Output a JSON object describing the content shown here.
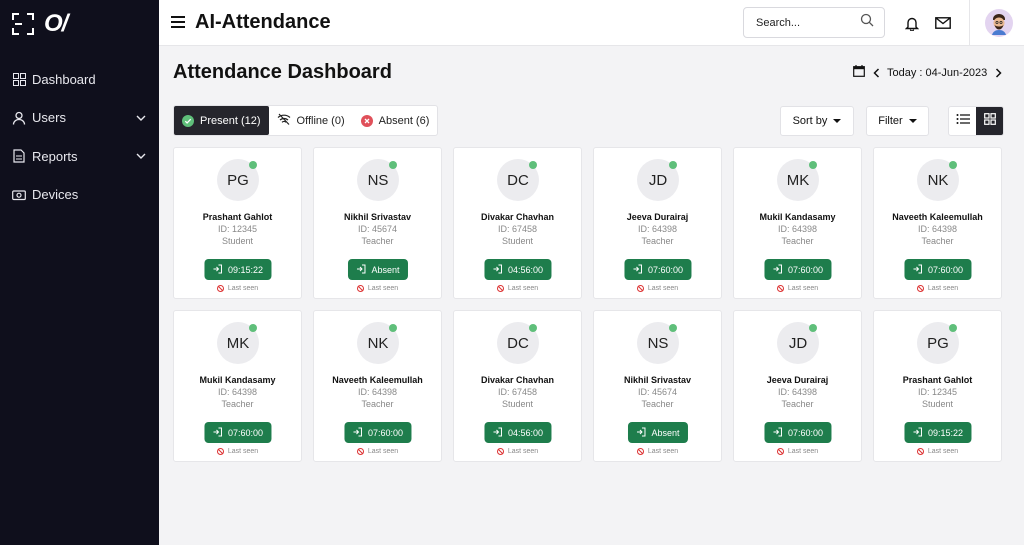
{
  "brand": {
    "logo_text": "O/"
  },
  "sidebar": {
    "items": [
      {
        "label": "Dashboard",
        "icon": "dashboard-icon",
        "has_chevron": false
      },
      {
        "label": "Users",
        "icon": "user-icon",
        "has_chevron": true
      },
      {
        "label": "Reports",
        "icon": "report-icon",
        "has_chevron": true
      },
      {
        "label": "Devices",
        "icon": "device-icon",
        "has_chevron": false
      }
    ]
  },
  "header": {
    "title": "AI-Attendance",
    "search_placeholder": "Search..."
  },
  "main": {
    "title": "Attendance Dashboard",
    "date_label": "Today : 04-Jun-2023",
    "tabs": [
      {
        "label": "Present (12)",
        "icon": "check-circle-icon",
        "active": true
      },
      {
        "label": "Offline (0)",
        "icon": "wifi-off-icon",
        "active": false
      },
      {
        "label": "Absent (6)",
        "icon": "x-circle-icon",
        "active": false
      }
    ],
    "sort_label": "Sort by",
    "filter_label": "Filter",
    "view_mode": "grid"
  },
  "colors": {
    "sidebar_bg": "#0f0f1c",
    "accent_green": "#1e7d4c",
    "online_dot": "#5fbf7a",
    "absent_red": "#e0505a"
  },
  "cards": [
    {
      "initials": "PG",
      "name": "Prashant Gahlot",
      "id": "ID: 12345",
      "role": "Student",
      "status": "09:15:22",
      "last_seen": "Last seen"
    },
    {
      "initials": "NS",
      "name": "Nikhil Srivastav",
      "id": "ID: 45674",
      "role": "Teacher",
      "status": "Absent",
      "last_seen": "Last seen"
    },
    {
      "initials": "DC",
      "name": "Divakar Chavhan",
      "id": "ID: 67458",
      "role": "Student",
      "status": "04:56:00",
      "last_seen": "Last seen"
    },
    {
      "initials": "JD",
      "name": "Jeeva Durairaj",
      "id": "ID: 64398",
      "role": "Teacher",
      "status": "07:60:00",
      "last_seen": "Last seen"
    },
    {
      "initials": "MK",
      "name": "Mukil Kandasamy",
      "id": "ID: 64398",
      "role": "Teacher",
      "status": "07:60:00",
      "last_seen": "Last seen"
    },
    {
      "initials": "NK",
      "name": "Naveeth Kaleemullah",
      "id": "ID: 64398",
      "role": "Teacher",
      "status": "07:60:00",
      "last_seen": "Last seen"
    },
    {
      "initials": "MK",
      "name": "Mukil Kandasamy",
      "id": "ID: 64398",
      "role": "Teacher",
      "status": "07:60:00",
      "last_seen": "Last seen"
    },
    {
      "initials": "NK",
      "name": "Naveeth Kaleemullah",
      "id": "ID: 64398",
      "role": "Teacher",
      "status": "07:60:00",
      "last_seen": "Last seen"
    },
    {
      "initials": "DC",
      "name": "Divakar Chavhan",
      "id": "ID: 67458",
      "role": "Student",
      "status": "04:56:00",
      "last_seen": "Last seen"
    },
    {
      "initials": "NS",
      "name": "Nikhil Srivastav",
      "id": "ID: 45674",
      "role": "Teacher",
      "status": "Absent",
      "last_seen": "Last seen"
    },
    {
      "initials": "JD",
      "name": "Jeeva Durairaj",
      "id": "ID: 64398",
      "role": "Teacher",
      "status": "07:60:00",
      "last_seen": "Last seen"
    },
    {
      "initials": "PG",
      "name": "Prashant Gahlot",
      "id": "ID: 12345",
      "role": "Student",
      "status": "09:15:22",
      "last_seen": "Last seen"
    }
  ]
}
